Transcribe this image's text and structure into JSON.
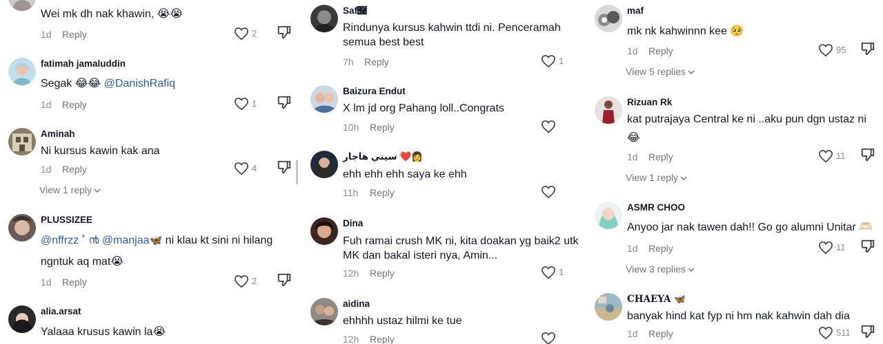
{
  "columns": [
    {
      "comments": [
        {
          "author": "",
          "text": "Wei mk dh nak khawin, 😭😭",
          "time": "1d",
          "reply": "Reply",
          "likes": "2"
        },
        {
          "author": "fatimah jamaluddin",
          "text": "Segak 😂😂",
          "mention": "@DanishRafiq",
          "time": "1d",
          "reply": "Reply",
          "likes": "1"
        },
        {
          "author": "Aminah",
          "text": "Ni kursus kawin kak ana",
          "time": "1d",
          "reply": "Reply",
          "likes": "4",
          "view_replies": "View 1 reply"
        },
        {
          "author": "PLUSSIZEE",
          "mention1": "@nffrzz ˚ ൯",
          "mention2": "@manjaa",
          "text_rest": "ni klau kt sini ni hilang",
          "text_line2": "ngntuk aq mat😭",
          "time": "1d",
          "reply": "Reply",
          "likes": "2"
        },
        {
          "author": "alia.arsat",
          "text": "Yalaaa krusus kawin la😭"
        }
      ]
    },
    {
      "comments": [
        {
          "author": "Saf🫉",
          "text": "Rindunya kursus kahwin ttdi ni. Penceramah semua best best",
          "time": "7h",
          "reply": "Reply",
          "likes": "1"
        },
        {
          "author": "Baizura Endut",
          "text": "X lm jd org Pahang loll..Congrats",
          "time": "10h",
          "reply": "Reply",
          "likes": ""
        },
        {
          "author": "سيتي هاجار 👩‍❤️",
          "text": "ehh ehh ehh saya ke ehh",
          "time": "11h",
          "reply": "Reply",
          "likes": ""
        },
        {
          "author": "Dina",
          "text": "Fuh ramai crush MK ni, kita doakan yg baik2 utk",
          "text_line2": "MK dan bakal isteri nya, Amin...",
          "time": "12h",
          "reply": "Reply",
          "likes": "1"
        },
        {
          "author": "aidina",
          "text": "ehhhh ustaz hilmi ke tue",
          "time": "12h",
          "reply": "Reply",
          "likes": ""
        }
      ]
    },
    {
      "comments": [
        {
          "author": "maf",
          "text": "mk nk kahwinnn kee 🥺",
          "time": "1d",
          "reply": "Reply",
          "likes": "95",
          "view_replies": "View 5 replies"
        },
        {
          "author": "Rizuan Rk",
          "text": "kat putrajaya Central ke ni ..aku pun dgn ustaz ni",
          "text_line2": "😂",
          "time": "1d",
          "reply": "Reply",
          "likes": "11",
          "view_replies": "View 1 reply"
        },
        {
          "author": "ASMR  CHOO",
          "text": "Anyoo jar nak tawen dah!! Go go alumni Unitar 🫶🏻",
          "time": "1d",
          "reply": "Reply",
          "likes": "11",
          "view_replies": "View 3 replies"
        },
        {
          "author": "CHAEYA 🦋",
          "text": "banyak hind kat fyp ni hm nak kahwin dah dia",
          "time": "1d",
          "reply": "Reply",
          "likes": "511"
        }
      ]
    }
  ],
  "colors": {
    "mention": "#2b5db9",
    "meta": "#8a8b91",
    "text": "#161823"
  },
  "icons": [
    "heart-icon",
    "dislike-icon",
    "chevron-down-icon"
  ]
}
